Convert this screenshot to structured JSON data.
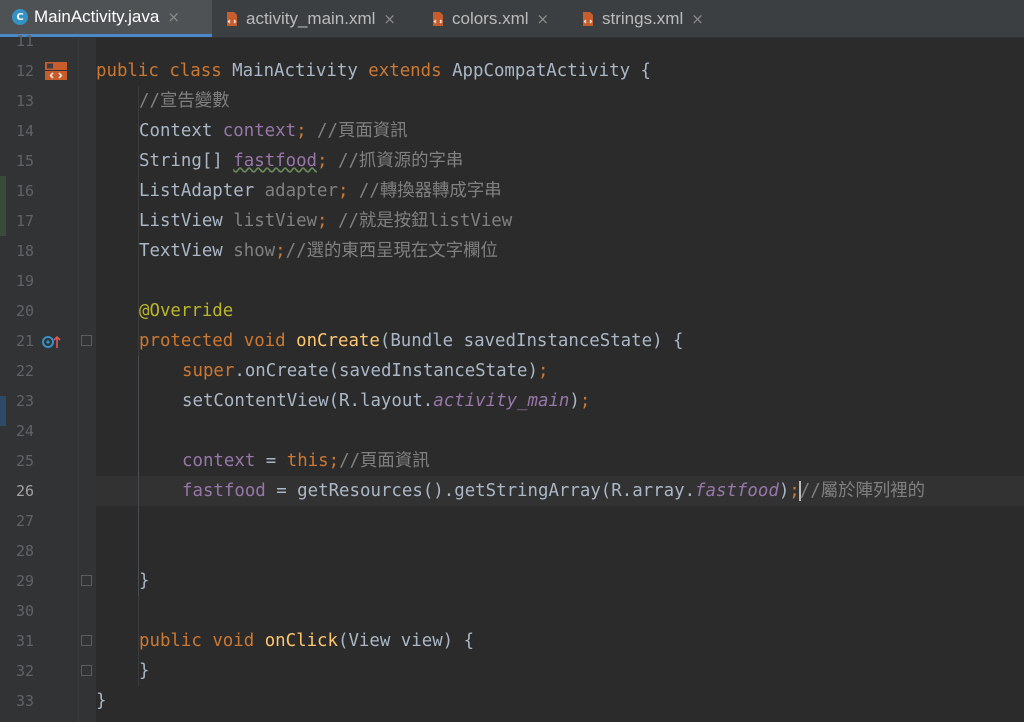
{
  "tabs": [
    {
      "label": "MainActivity.java",
      "icon": "java-class-icon",
      "active": true
    },
    {
      "label": "activity_main.xml",
      "icon": "xml-layout-icon",
      "active": false
    },
    {
      "label": "colors.xml",
      "icon": "xml-layout-icon",
      "active": false
    },
    {
      "label": "strings.xml",
      "icon": "xml-layout-icon",
      "active": false
    }
  ],
  "close_glyph": "×",
  "line_numbers": [
    "11",
    "12",
    "13",
    "14",
    "15",
    "16",
    "17",
    "18",
    "19",
    "20",
    "21",
    "22",
    "23",
    "24",
    "25",
    "26",
    "27",
    "28",
    "29",
    "30",
    "31",
    "32",
    "33"
  ],
  "current_line": "26",
  "code": {
    "l12": [
      "public",
      "class",
      "MainActivity",
      "extends",
      "AppCompatActivity",
      "{"
    ],
    "l13": "//宣告變數",
    "l14": [
      "Context",
      "context",
      ";",
      "//頁面資訊"
    ],
    "l15": [
      "String[]",
      "fastfood",
      ";",
      "//抓資源的字串"
    ],
    "l16": [
      "ListAdapter",
      "adapter",
      ";",
      "//轉換器轉成字串"
    ],
    "l17": [
      "ListView",
      "listView",
      ";",
      "//就是按鈕listView"
    ],
    "l18": [
      "TextView",
      "show",
      ";",
      "//選的東西呈現在文字欄位"
    ],
    "l20": "@Override",
    "l21": [
      "protected",
      "void",
      "onCreate",
      "(Bundle savedInstanceState) {"
    ],
    "l22": [
      "super",
      ".onCreate(savedInstanceState)",
      ";"
    ],
    "l23": [
      "setContentView(R.layout.",
      "activity_main",
      ")",
      ";"
    ],
    "l25": [
      "context",
      " = ",
      "this",
      ";",
      "//頁面資訊"
    ],
    "l26": [
      "fastfood",
      " = getResources().getStringArray(R.array.",
      "fastfood",
      ")",
      ";",
      "//屬於陣列裡的"
    ],
    "l29": "}",
    "l31": [
      "public",
      "void",
      "onClick",
      "(View view) {"
    ],
    "l32": "}",
    "l33": "}"
  }
}
